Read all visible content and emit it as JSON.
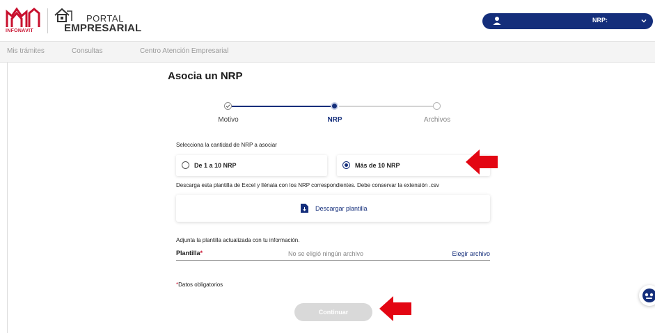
{
  "header": {
    "brand_infonavit": "INFONAVIT",
    "portal_word": "PORTAL",
    "empresarial_word": "EMPRESARIAL",
    "nrp_label": "NRP:",
    "colors": {
      "brand_blue": "#142e7b",
      "brand_red": "#c8102e"
    }
  },
  "nav": {
    "items": [
      {
        "label": "Mis trámites"
      },
      {
        "label": "Consultas"
      },
      {
        "label": "Centro Atención Empresarial"
      }
    ]
  },
  "main": {
    "title": "Asocia un NRP",
    "stepper": {
      "steps": [
        {
          "label": "Motivo",
          "state": "completed"
        },
        {
          "label": "NRP",
          "state": "active"
        },
        {
          "label": "Archivos",
          "state": "pending"
        }
      ]
    },
    "quantity_prompt": "Selecciona la cantidad de NRP a asociar",
    "options": [
      {
        "label": "De 1 a 10 NRP",
        "selected": false
      },
      {
        "label": "Más de 10 NRP",
        "selected": true
      }
    ],
    "download_instructions": "Descarga esta plantilla de Excel y llénala con los NRP correspondientes. Debe conservar la extensión .csv",
    "download_label": "Descargar plantilla",
    "attach_instructions": "Adjunta la plantilla actualizada con tu información.",
    "file_field": {
      "label": "Plantilla",
      "required_mark": "*",
      "empty_text": "No se eligió ningún archivo",
      "choose_label": "Elegir archivo"
    },
    "required_note": "Datos obligatorios",
    "required_mark": "*",
    "continue_label": "Continuar"
  },
  "annotations": {
    "arrow_color": "#e30613"
  },
  "icons": {
    "user": "user-icon",
    "chevron": "chevron-down-icon",
    "file": "file-download-icon",
    "check": "check-icon",
    "help": "chatbot-icon"
  }
}
